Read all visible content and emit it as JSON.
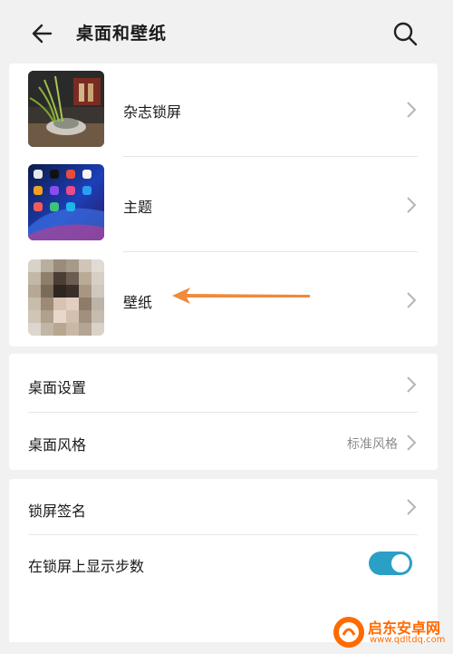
{
  "header": {
    "title": "桌面和壁纸",
    "back_icon": "arrow-left-icon",
    "search_icon": "search-icon"
  },
  "section1": {
    "items": [
      {
        "label": "杂志锁屏"
      },
      {
        "label": "主题"
      },
      {
        "label": "壁纸"
      }
    ]
  },
  "section2": {
    "items": [
      {
        "label": "桌面设置"
      },
      {
        "label": "桌面风格",
        "value": "标准风格"
      }
    ]
  },
  "section3": {
    "items": [
      {
        "label": "锁屏签名"
      },
      {
        "label": "在锁屏上显示步数",
        "toggle_on": true
      }
    ]
  },
  "watermark": {
    "name": "启东安卓网",
    "url": "www.qdltdq.com"
  },
  "colors": {
    "background": "#f1f1f1",
    "card": "#ffffff",
    "toggle_on": "#2aa0c7",
    "annotation_arrow": "#f08a3c",
    "watermark": "#ff6a00"
  }
}
